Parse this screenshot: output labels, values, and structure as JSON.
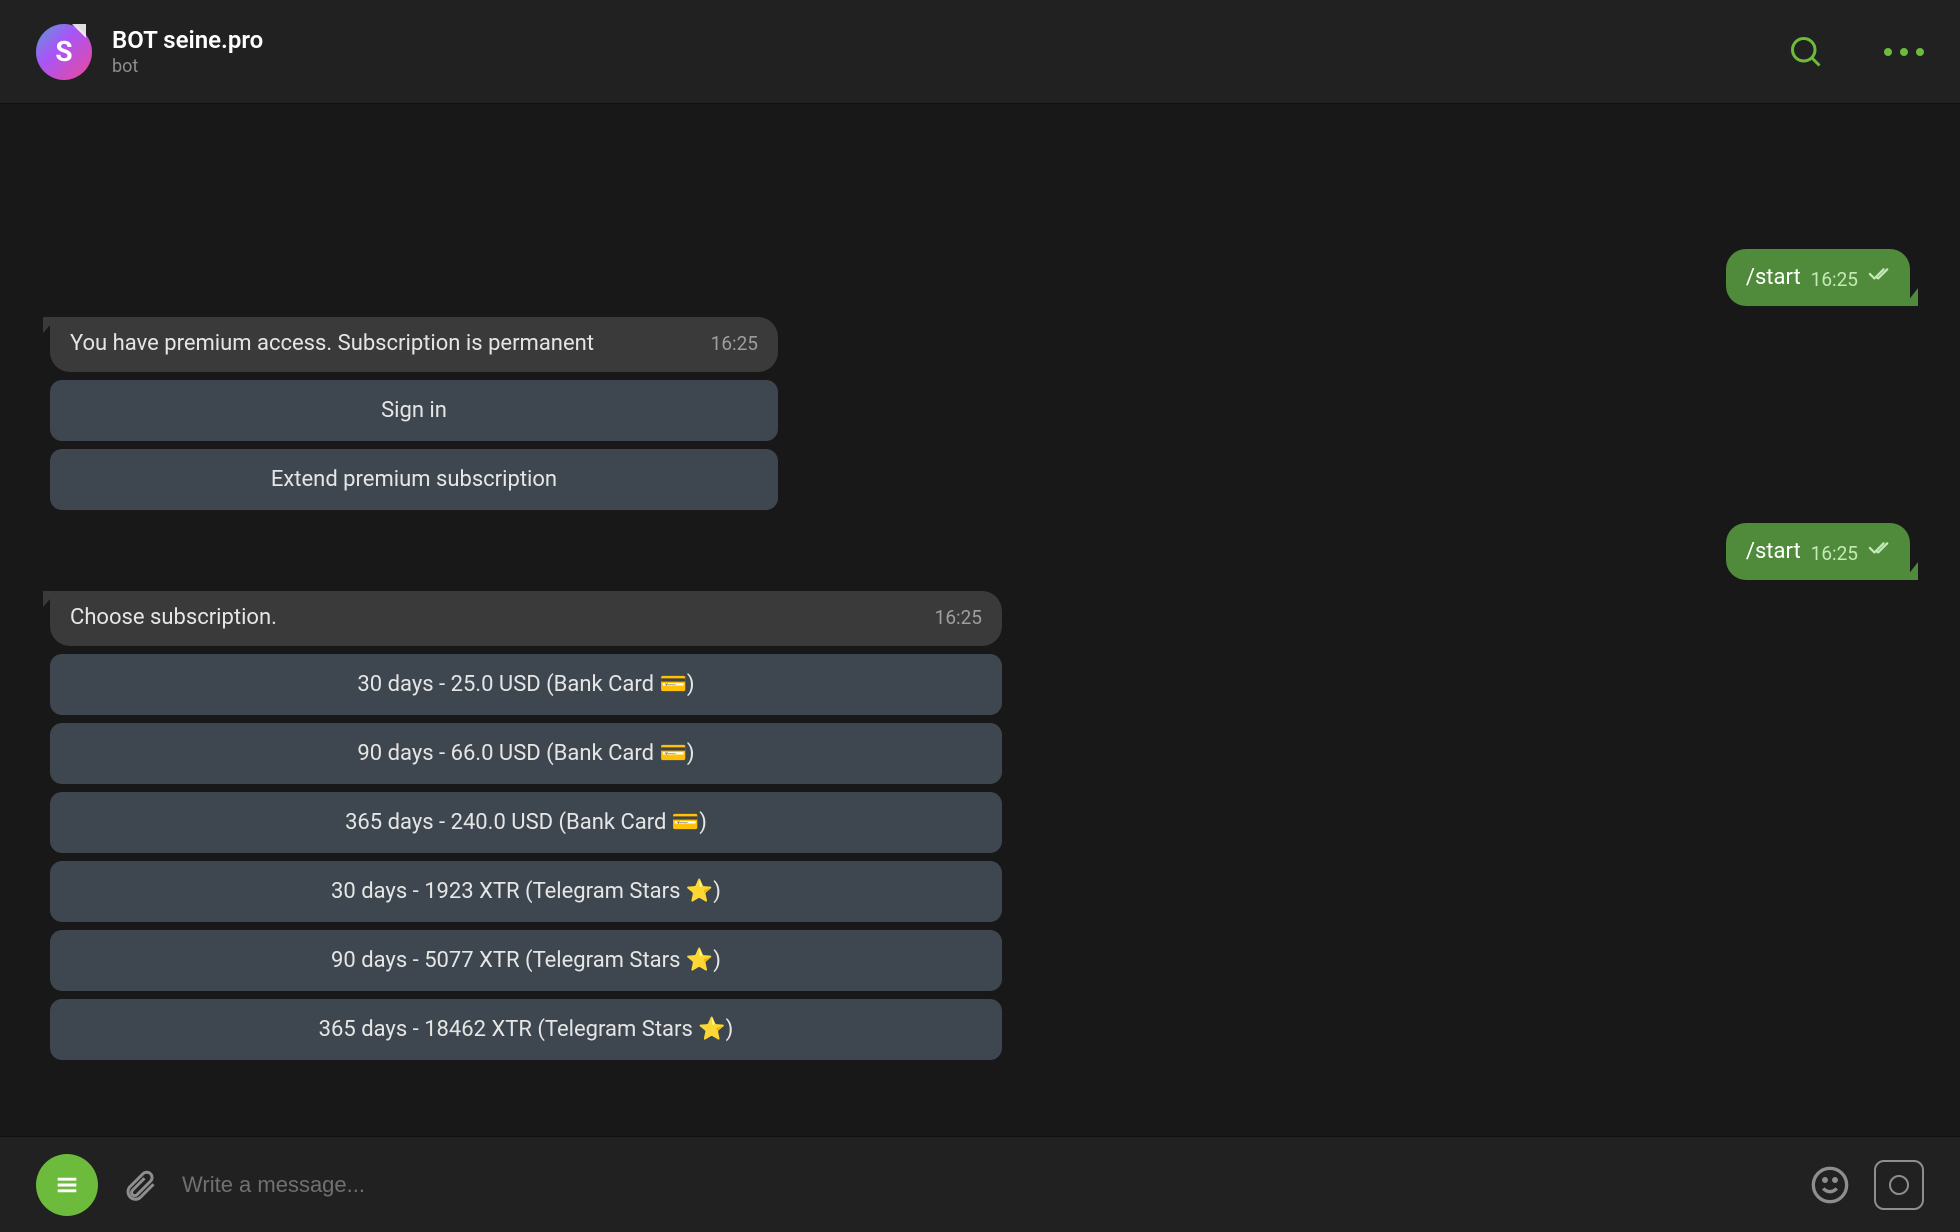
{
  "header": {
    "avatar_letter": "S",
    "title": "BOT seine.pro",
    "subtitle": "bot"
  },
  "messages": {
    "out1": {
      "text": "/start",
      "time": "16:25"
    },
    "in1": {
      "text": "You have premium access. Subscription is permanent",
      "time": "16:25",
      "buttons": [
        "Sign in",
        "Extend premium subscription"
      ]
    },
    "out2": {
      "text": "/start",
      "time": "16:25"
    },
    "in2": {
      "text": "Choose subscription.",
      "time": "16:25",
      "buttons": [
        "30 days - 25.0 USD (Bank Card 💳)",
        "90 days - 66.0 USD (Bank Card 💳)",
        "365 days - 240.0 USD (Bank Card 💳)",
        "30 days - 1923 XTR (Telegram Stars ⭐)",
        "90 days - 5077 XTR (Telegram Stars ⭐)",
        "365 days - 18462 XTR (Telegram Stars ⭐)"
      ]
    }
  },
  "input": {
    "placeholder": "Write a message..."
  }
}
